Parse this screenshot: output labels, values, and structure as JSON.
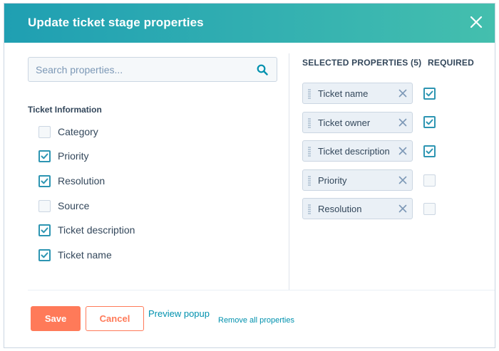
{
  "modal": {
    "title": "Update ticket stage properties"
  },
  "search": {
    "placeholder": "Search properties..."
  },
  "group": {
    "label": "Ticket Information",
    "options": [
      {
        "label": "Category",
        "checked": false
      },
      {
        "label": "Priority",
        "checked": true
      },
      {
        "label": "Resolution",
        "checked": true
      },
      {
        "label": "Source",
        "checked": false
      },
      {
        "label": "Ticket description",
        "checked": true
      },
      {
        "label": "Ticket name",
        "checked": true
      }
    ]
  },
  "selected": {
    "heading": "SELECTED PROPERTIES (5)",
    "required_heading": "REQUIRED",
    "items": [
      {
        "label": "Ticket name",
        "required": true
      },
      {
        "label": "Ticket owner",
        "required": true
      },
      {
        "label": "Ticket description",
        "required": true
      },
      {
        "label": "Priority",
        "required": false
      },
      {
        "label": "Resolution",
        "required": false
      }
    ]
  },
  "footer": {
    "save_label": "Save",
    "cancel_label": "Cancel",
    "preview_label": "Preview popup",
    "remove_all_label": "Remove all properties"
  },
  "colors": {
    "header_start": "#1f9fb2",
    "header_end": "#44bfae",
    "accent_orange": "#ff7a59",
    "check_blue": "#2d95b2",
    "link_blue": "#0091ae"
  },
  "icons": {
    "close": "close-icon",
    "search": "search-icon",
    "check": "checkmark-icon",
    "drag": "drag-handle-icon",
    "remove": "remove-x-icon"
  }
}
